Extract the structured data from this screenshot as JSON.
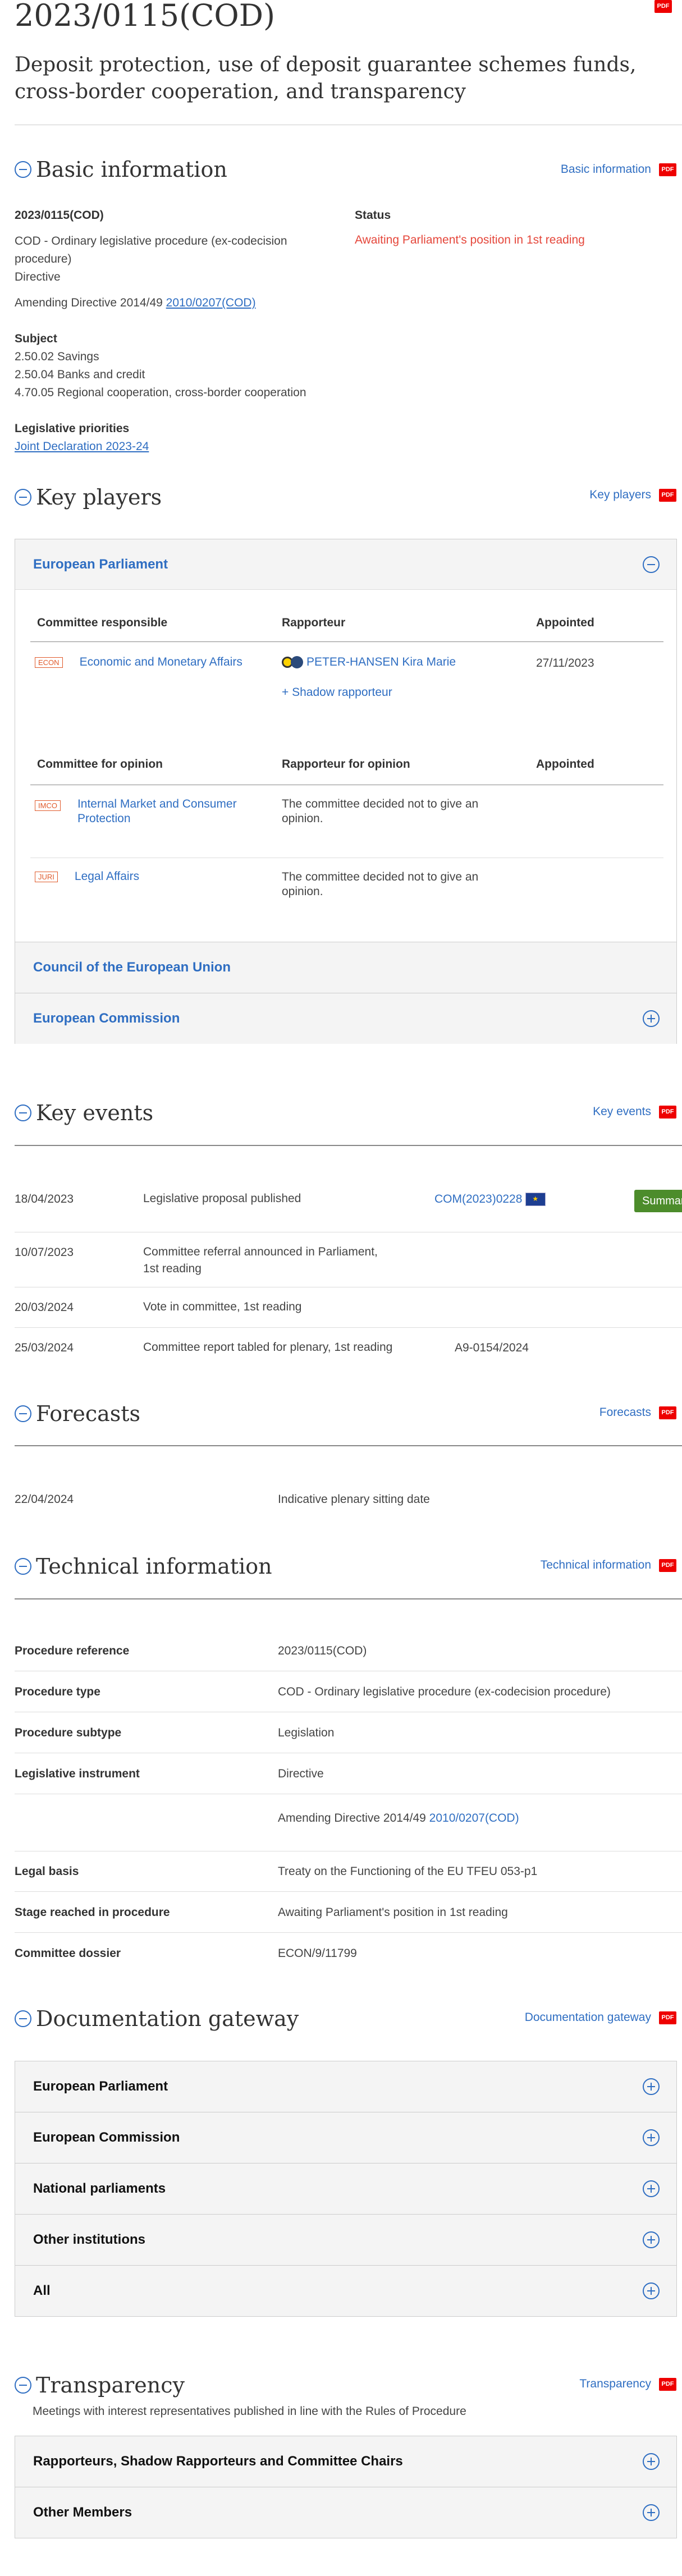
{
  "header": {
    "title": "2023/0115(COD)",
    "subtitle": "Deposit protection, use of deposit guarantee schemes funds, cross-border cooperation, and transparency",
    "pdf_label": "PDF"
  },
  "basic": {
    "section_title": "Basic information",
    "link": "Basic information",
    "ref": "2023/0115(COD)",
    "proc_line1": "COD - Ordinary legislative procedure (ex-codecision",
    "proc_line2": "procedure)",
    "type": "Directive",
    "amending_prefix": "Amending Directive 2014/49",
    "amending_link": "2010/0207(COD)",
    "status_label": "Status",
    "status_value": "Awaiting Parliament's position in 1st reading",
    "subject_label": "Subject",
    "subjects": [
      "2.50.02 Savings",
      "2.50.04 Banks and credit",
      "4.70.05 Regional cooperation, cross-border cooperation"
    ],
    "priorities_label": "Legislative priorities",
    "priorities_link": "Joint Declaration 2023-24"
  },
  "key_players": {
    "section_title": "Key players",
    "link": "Key players",
    "ep_title": "European Parliament",
    "col_committee": "Committee responsible",
    "col_rapporteur": "Rapporteur",
    "col_appointed": "Appointed",
    "resp_tag": "ECON",
    "resp_name": "Economic and Monetary Affairs",
    "rapporteur": "PETER-HANSEN Kira Marie",
    "appointed": "27/11/2023",
    "shadow": "+ Shadow rapporteur",
    "col_opinion": "Committee for opinion",
    "col_rap_opinion": "Rapporteur for opinion",
    "col_appointed2": "Appointed",
    "opinions": [
      {
        "tag": "IMCO",
        "name_l1": "Internal Market and Consumer",
        "name_l2": "Protection",
        "rap_l1": "The committee decided not to give an",
        "rap_l2": "opinion."
      },
      {
        "tag": "JURI",
        "name_l1": "Legal Affairs",
        "name_l2": "",
        "rap_l1": "The committee decided not to give an",
        "rap_l2": "opinion."
      }
    ],
    "council": "Council of the European Union",
    "commission": "European Commission"
  },
  "key_events": {
    "section_title": "Key events",
    "link": "Key events",
    "events": [
      {
        "date": "18/04/2023",
        "desc_l1": "Legislative proposal published",
        "desc_l2": "",
        "ref": "COM(2023)0228"
      },
      {
        "date": "10/07/2023",
        "desc_l1": "Committee referral announced in Parliament,",
        "desc_l2": "1st reading",
        "ref": ""
      },
      {
        "date": "20/03/2024",
        "desc_l1": "Vote in committee, 1st reading",
        "desc_l2": "",
        "ref": ""
      },
      {
        "date": "25/03/2024",
        "desc_l1": "Committee report tabled for plenary, 1st reading",
        "desc_l2": "",
        "ref": "A9-0154/2024"
      }
    ],
    "summary_button": "Summary"
  },
  "forecasts": {
    "section_title": "Forecasts",
    "link": "Forecasts",
    "date": "22/04/2024",
    "desc": "Indicative plenary sitting date"
  },
  "technical": {
    "section_title": "Technical information",
    "link": "Technical information",
    "rows": [
      {
        "label": "Procedure reference",
        "value": "2023/0115(COD)"
      },
      {
        "label": "Procedure type",
        "value": "COD - Ordinary legislative procedure (ex-codecision procedure)"
      },
      {
        "label": "Procedure subtype",
        "value": "Legislation"
      },
      {
        "label": "Legislative instrument",
        "value": "Directive"
      }
    ],
    "amending_prefix": "Amending Directive 2014/49",
    "amending_link": "2010/0207(COD)",
    "rows2": [
      {
        "label": "Legal basis",
        "value": "Treaty on the Functioning of the EU TFEU 053-p1"
      },
      {
        "label": "Stage reached in procedure",
        "value": "Awaiting Parliament's position in 1st reading"
      },
      {
        "label": "Committee dossier",
        "value": "ECON/9/11799"
      }
    ]
  },
  "documentation": {
    "section_title": "Documentation gateway",
    "link": "Documentation gateway",
    "items": [
      "European Parliament",
      "European Commission",
      "National parliaments",
      "Other institutions",
      "All"
    ]
  },
  "transparency": {
    "section_title": "Transparency",
    "link": "Transparency",
    "note": "Meetings with interest representatives published in line with the Rules of Procedure",
    "items": [
      "Rapporteurs, Shadow Rapporteurs and Committee Chairs",
      "Other Members"
    ]
  },
  "colors": {
    "accent": "#2f6ec2",
    "status_red": "#e5473b",
    "pdf_red": "#e00000",
    "summary_green": "#4c8c2b",
    "tag_orange": "#e05a2b"
  }
}
